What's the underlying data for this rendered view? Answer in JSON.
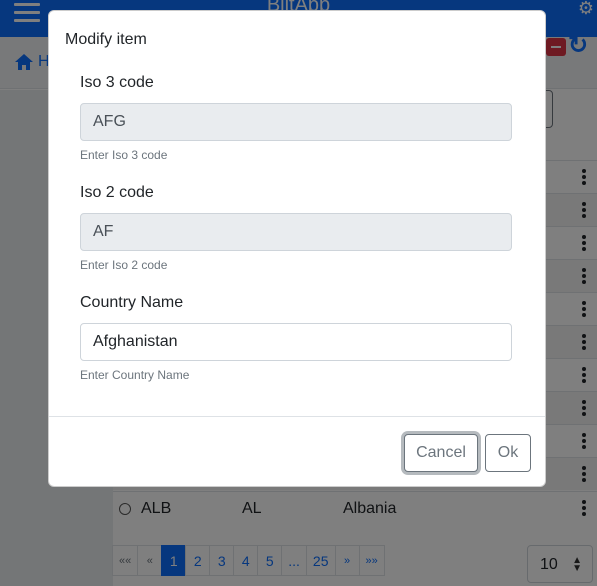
{
  "app": {
    "title": "BlitApp",
    "home_label": "H"
  },
  "table": {
    "visible_row": {
      "iso3": "ALB",
      "iso2": "AL",
      "name": "Albania"
    }
  },
  "pagination": {
    "first": "««",
    "prev": "«",
    "pages": [
      "1",
      "2",
      "3",
      "4",
      "5",
      "...",
      "25"
    ],
    "active_page": "1",
    "next": "»",
    "last": "»»",
    "page_size": "10"
  },
  "modal": {
    "title": "Modify item",
    "fields": [
      {
        "label": "Iso 3 code",
        "value": "AFG",
        "help": "Enter Iso 3 code",
        "readonly": true
      },
      {
        "label": "Iso 2 code",
        "value": "AF",
        "help": "Enter Iso 2 code",
        "readonly": true
      },
      {
        "label": "Country Name",
        "value": "Afghanistan",
        "help": "Enter Country Name",
        "readonly": false
      }
    ],
    "cancel_label": "Cancel",
    "ok_label": "Ok"
  },
  "colors": {
    "primary": "#0d6efd",
    "danger": "#dc3545",
    "secondary": "#6c757d"
  },
  "icons": [
    "hamburger-icon",
    "gear-icon",
    "home-icon",
    "delete-icon",
    "refresh-icon",
    "kebab-menu-icon",
    "sort-arrows-icon"
  ]
}
